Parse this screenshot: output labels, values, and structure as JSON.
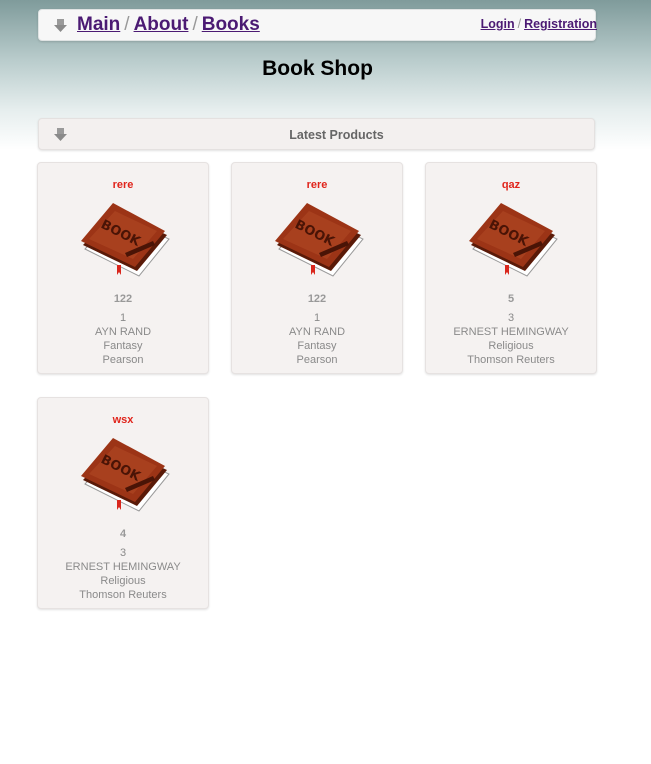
{
  "header": {
    "breadcrumb": [
      {
        "label": "Main"
      },
      {
        "label": "About"
      },
      {
        "label": "Books"
      }
    ],
    "separator": "/",
    "auth": {
      "login_label": "Login",
      "separator": "/",
      "registration_label": "Registration"
    }
  },
  "page_title": "Book Shop",
  "section": {
    "title": "Latest Products"
  },
  "products": [
    {
      "title": "rere",
      "price": "122",
      "quantity": "1",
      "author": "AYN RAND",
      "genre": "Fantasy",
      "publisher": "Pearson"
    },
    {
      "title": "rere",
      "price": "122",
      "quantity": "1",
      "author": "AYN RAND",
      "genre": "Fantasy",
      "publisher": "Pearson"
    },
    {
      "title": "qaz",
      "price": "5",
      "quantity": "3",
      "author": "ERNEST HEMINGWAY",
      "genre": "Religious",
      "publisher": "Thomson Reuters"
    },
    {
      "title": "wsx",
      "price": "4",
      "quantity": "3",
      "author": "ERNEST HEMINGWAY",
      "genre": "Religious",
      "publisher": "Thomson Reuters"
    }
  ],
  "colors": {
    "link": "#4b1a73",
    "product_title": "#e0241b",
    "book_cover": "#8f2e13"
  },
  "icons": {
    "bar_arrow": "arrow-down-icon",
    "product_image": "book-icon"
  }
}
